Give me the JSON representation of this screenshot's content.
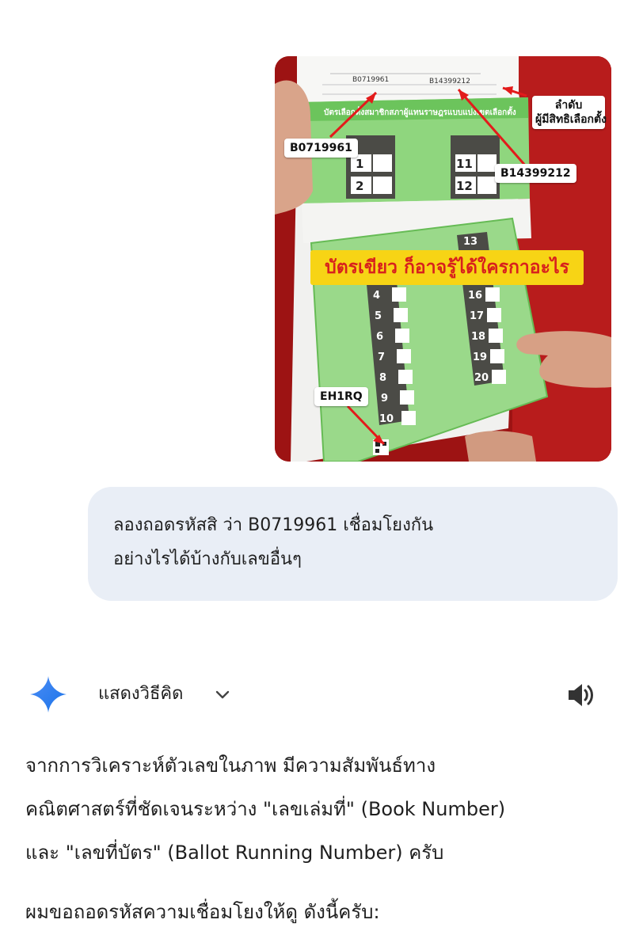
{
  "attachment": {
    "callouts": {
      "book_number": "B0719961",
      "ballot_number": "B14399212",
      "order_line1": "ลำดับ",
      "order_line2": "ผู้มีสิทธิเลือกตั้ง",
      "code": "EH1RQ"
    },
    "banner": "บัตรเขียว  ก็อาจรู้ได้ใครกาอะไร",
    "stub_numbers": [
      "B0719961",
      "B14399212"
    ],
    "ballot_title": "บัตรเลือกตั้งสมาชิกสภาผู้แทนราษฎรแบบแบ่งเขตเลือกตั้ง",
    "candidate_numbers_back": [
      "1",
      "2",
      "11",
      "12"
    ],
    "candidate_numbers_front_left": [
      "4",
      "5",
      "6",
      "7",
      "8",
      "9",
      "10"
    ],
    "candidate_numbers_front_right": [
      "13",
      "16",
      "17",
      "18",
      "19",
      "20"
    ],
    "colors": {
      "ballot_green": "#7fcf6e",
      "banner_yellow": "#f7d415",
      "banner_text": "#d8211d",
      "background_red": "#9d1313"
    }
  },
  "user_message": {
    "line1": "ลองถอดรหัสสิ ว่า B0719961 เชื่อมโยงกัน",
    "line2": "อย่างไรได้บ้างกับเลขอื่นๆ"
  },
  "model": {
    "icon": "gemini-sparkle-icon",
    "show_thinking_label": "แสดงวิธีคิด",
    "chevron_icon": "chevron-down-icon",
    "speaker_icon": "speaker-icon",
    "response": {
      "p1_line1": "จากการวิเคราะห์ตัวเลขในภาพ มีความสัมพันธ์ทาง",
      "p1_line2": "คณิตศาสตร์ที่ชัดเจนระหว่าง \"เลขเล่มที่\" (Book Number)",
      "p1_line3": "และ \"เลขที่บัตร\" (Ballot Running Number) ครับ",
      "p2_line1": "ผมขอถอดรหัสความเชื่อมโยงให้ดู ดังนี้ครับ:"
    }
  }
}
